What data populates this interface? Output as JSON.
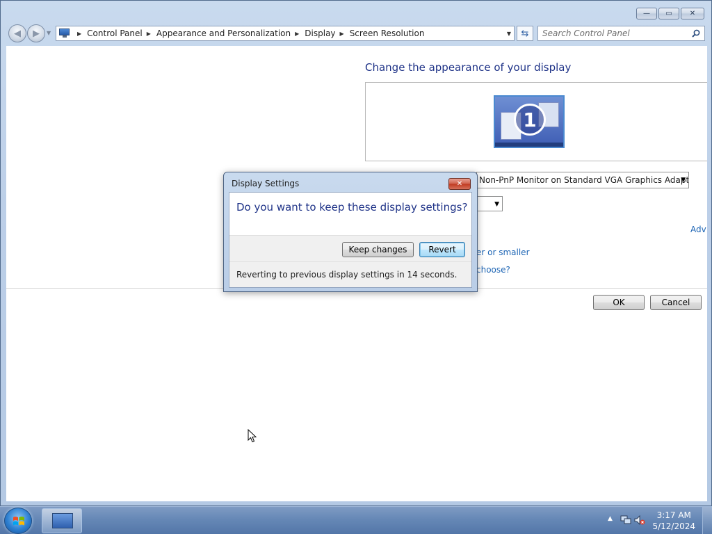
{
  "window": {
    "minimize_glyph": "—",
    "maximize_glyph": "▭",
    "close_glyph": "✕"
  },
  "nav": {
    "back_icon": "back-arrow-icon",
    "forward_icon": "forward-arrow-icon",
    "breadcrumbs": [
      "Control Panel",
      "Appearance and Personalization",
      "Display",
      "Screen Resolution"
    ],
    "search_placeholder": "Search Control Panel"
  },
  "content": {
    "title": "Change the appearance of your display",
    "monitor_number": "1",
    "display_value": "Non-PnP Monitor on Standard VGA Graphics Adapter",
    "advanced_link": "Adv",
    "link_bigger_smaller": "er or smaller",
    "link_choose": "choose?",
    "ok_label": "OK",
    "cancel_label": "Cancel"
  },
  "dialog": {
    "title": "Display Settings",
    "question": "Do you want to keep these display settings?",
    "keep_label": "Keep changes",
    "revert_label": "Revert",
    "countdown_text": "Reverting to previous display settings in 14 seconds."
  },
  "taskbar": {
    "time": "3:17 AM",
    "date": "5/12/2024"
  },
  "colors": {
    "title_blue": "#1e3287",
    "link_blue": "#1c64b4",
    "taskbar": "#5376a8"
  }
}
